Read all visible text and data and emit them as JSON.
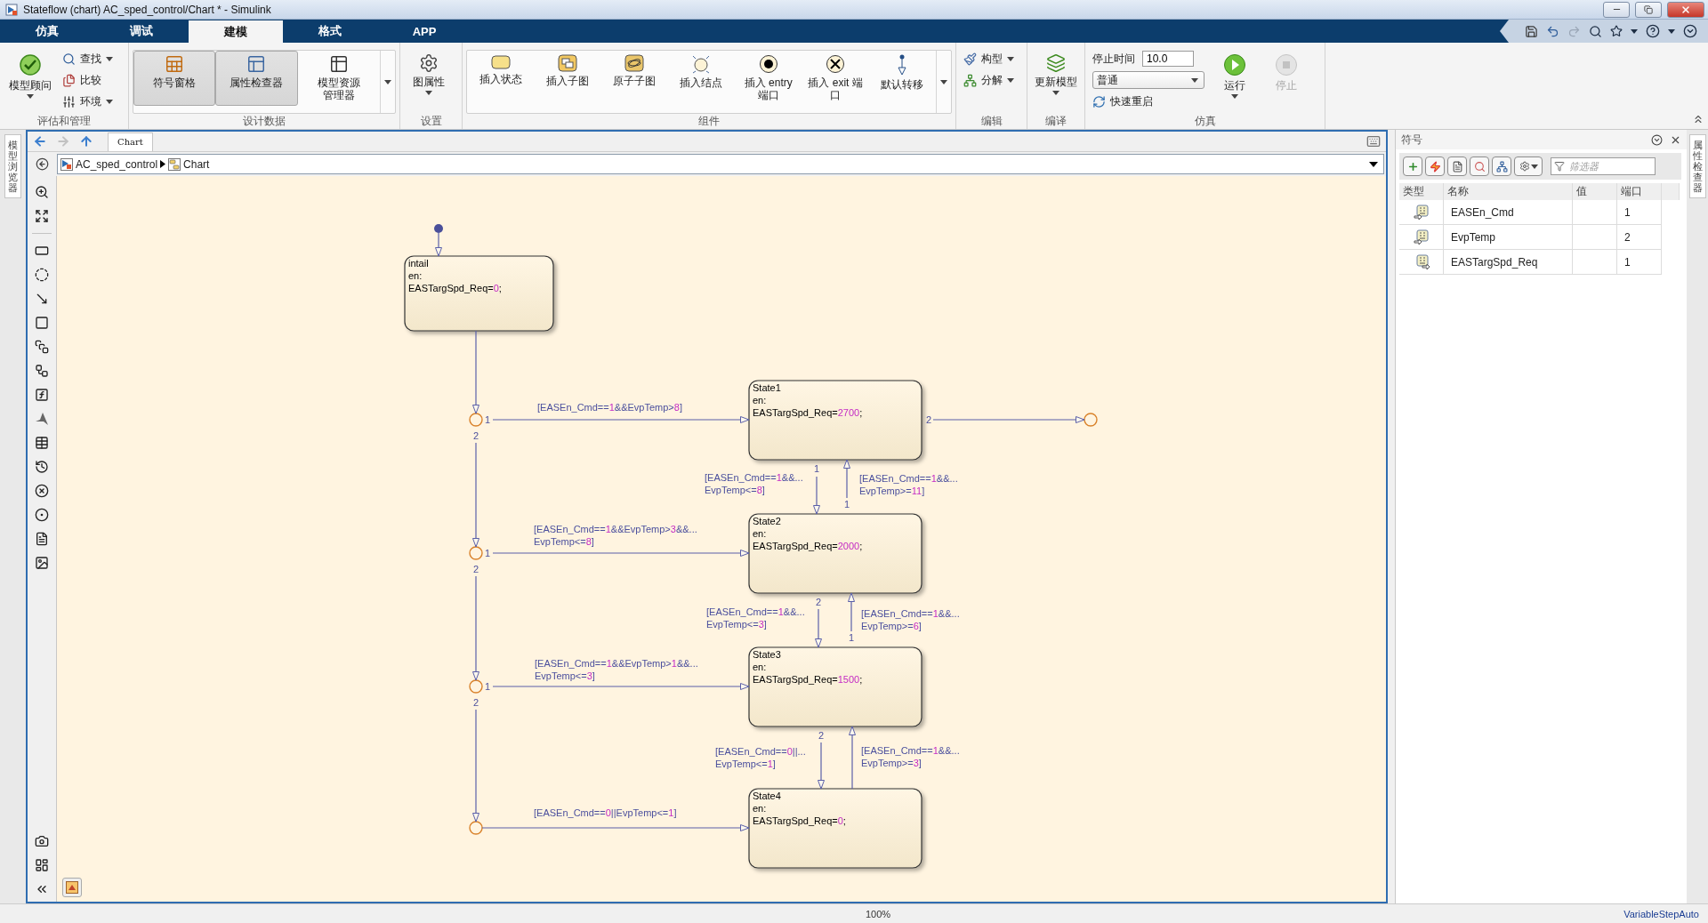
{
  "window": {
    "title": "Stateflow (chart) AC_sped_control/Chart * - Simulink"
  },
  "ribbon_tabs": [
    {
      "label": "仿真",
      "selected": false
    },
    {
      "label": "调试",
      "selected": false
    },
    {
      "label": "建模",
      "selected": true
    },
    {
      "label": "格式",
      "selected": false
    },
    {
      "label": "APP",
      "selected": false
    }
  ],
  "toolstrip": [
    {
      "label": "评估和管理",
      "more": false,
      "items": [
        {
          "kind": "large",
          "lines": [
            "模型顾问"
          ],
          "dropdown": true
        },
        {
          "kind": "small",
          "label": "查找",
          "dropdown": true
        },
        {
          "kind": "small",
          "label": "比较",
          "dropdown": false
        },
        {
          "kind": "small",
          "label": "环境",
          "dropdown": true
        }
      ]
    },
    {
      "label": "设计数据",
      "more": true,
      "items": [
        {
          "kind": "large",
          "lines": [
            "符号窗格"
          ],
          "dropdown": false,
          "pressed": true
        },
        {
          "kind": "large",
          "lines": [
            "属性检查器"
          ],
          "dropdown": false,
          "pressed": true
        },
        {
          "kind": "large",
          "lines": [
            "模型资源",
            "管理器"
          ],
          "dropdown": false,
          "pressed": false
        }
      ]
    },
    {
      "label": "设置",
      "more": false,
      "items": [
        {
          "kind": "large",
          "lines": [
            "图属性"
          ],
          "dropdown": true
        }
      ]
    },
    {
      "label": "组件",
      "more": true,
      "items": [
        {
          "kind": "large",
          "lines": [
            "插入状态"
          ],
          "dropdown": false
        },
        {
          "kind": "large",
          "lines": [
            "插入子图"
          ],
          "dropdown": false
        },
        {
          "kind": "large",
          "lines": [
            "原子子图"
          ],
          "dropdown": false
        },
        {
          "kind": "large",
          "lines": [
            "插入结点"
          ],
          "dropdown": false
        },
        {
          "kind": "large",
          "lines": [
            "插入 entry",
            "端口"
          ],
          "dropdown": false
        },
        {
          "kind": "large",
          "lines": [
            "插入 exit 端",
            "口"
          ],
          "dropdown": false
        },
        {
          "kind": "large",
          "lines": [
            "默认转移"
          ],
          "dropdown": false
        }
      ]
    },
    {
      "label": "编辑",
      "more": false,
      "items": [
        {
          "kind": "small",
          "label": "构型",
          "dropdown": true
        },
        {
          "kind": "small",
          "label": "分解",
          "dropdown": true
        }
      ]
    },
    {
      "label": "编译",
      "more": false,
      "items": [
        {
          "kind": "large",
          "lines": [
            "更新模型"
          ],
          "dropdown": true
        }
      ]
    },
    {
      "label": "仿真",
      "more": false,
      "items": [
        {
          "kind": "field",
          "label": "停止时间",
          "value": "10.0"
        },
        {
          "kind": "select",
          "value": "普通"
        },
        {
          "kind": "small",
          "label": "快速重启",
          "dropdown": false
        },
        {
          "kind": "large",
          "lines": [
            "运行"
          ],
          "dropdown": true,
          "disabled": false
        },
        {
          "kind": "large",
          "lines": [
            "停止"
          ],
          "dropdown": false,
          "disabled": true
        }
      ]
    }
  ],
  "side_tabs": {
    "left": "模型浏览器",
    "right": "属性检查器"
  },
  "editor": {
    "tab": "Chart",
    "breadcrumb": [
      {
        "label": "AC_sped_control"
      },
      {
        "label": "Chart"
      }
    ],
    "chart": {
      "states": [
        {
          "name": "intail",
          "entry": "en:",
          "action": "EASTargSpd_Req=0;"
        },
        {
          "name": "State1",
          "entry": "en:",
          "action": "EASTargSpd_Req=2700;"
        },
        {
          "name": "State2",
          "entry": "en:",
          "action": "EASTargSpd_Req=2000;"
        },
        {
          "name": "State3",
          "entry": "en:",
          "action": "EASTargSpd_Req=1500;"
        },
        {
          "name": "State4",
          "entry": "en:",
          "action": "EASTargSpd_Req=0;"
        }
      ],
      "junctions": [
        {
          "kind": "connective"
        },
        {
          "kind": "connective"
        },
        {
          "kind": "connective"
        },
        {
          "kind": "connective"
        },
        {
          "kind": "connective"
        }
      ],
      "transitions": [
        {
          "kind": "default"
        },
        {
          "kind": "plain"
        },
        {
          "kind": "plain",
          "label": [
            "[EASEn_Cmd==1&&EvpTemp>8]"
          ],
          "order": "1"
        },
        {
          "kind": "plain",
          "order": "2"
        },
        {
          "kind": "plain",
          "label": [
            "[EASEn_Cmd==1&&EvpTemp>3&&...",
            "EvpTemp<=8]"
          ],
          "order": "1"
        },
        {
          "kind": "plain",
          "order": "2"
        },
        {
          "kind": "plain",
          "label": [
            "[EASEn_Cmd==1&&EvpTemp>1&&...",
            "EvpTemp<=3]"
          ],
          "order": "1"
        },
        {
          "kind": "plain",
          "order": "2"
        },
        {
          "kind": "plain",
          "label": [
            "[EASEn_Cmd==0||EvpTemp<=1]"
          ]
        },
        {
          "kind": "plain",
          "order": "2"
        },
        {
          "kind": "plain",
          "label": [
            "[EASEn_Cmd==1&&...",
            "EvpTemp<=8]"
          ],
          "order": "1"
        },
        {
          "kind": "plain",
          "label": [
            "[EASEn_Cmd==1&&...",
            "EvpTemp>=11]"
          ],
          "order": "1"
        },
        {
          "kind": "plain",
          "label": [
            "[EASEn_Cmd==1&&...",
            "EvpTemp<=3]"
          ],
          "order": "2"
        },
        {
          "kind": "plain",
          "label": [
            "[EASEn_Cmd==1&&...",
            "EvpTemp>=6]"
          ],
          "order": "1"
        },
        {
          "kind": "plain",
          "label": [
            "[EASEn_Cmd==0||...",
            "EvpTemp<=1]"
          ],
          "order": "2"
        },
        {
          "kind": "plain",
          "label": [
            "[EASEn_Cmd==1&&...",
            "EvpTemp>=3]"
          ]
        }
      ]
    }
  },
  "symbols": {
    "title": "符号",
    "filter_placeholder": "筛选器",
    "columns": [
      "类型",
      "名称",
      "值",
      "端口"
    ],
    "rows": [
      {
        "kind": "input",
        "name": "EASEn_Cmd",
        "port": "1"
      },
      {
        "kind": "input",
        "name": "EvpTemp",
        "port": "2"
      },
      {
        "kind": "output",
        "name": "EASTargSpd_Req",
        "port": "1"
      }
    ]
  },
  "status_bar": {
    "zoom": "100%",
    "solver": "VariableStepAuto"
  }
}
